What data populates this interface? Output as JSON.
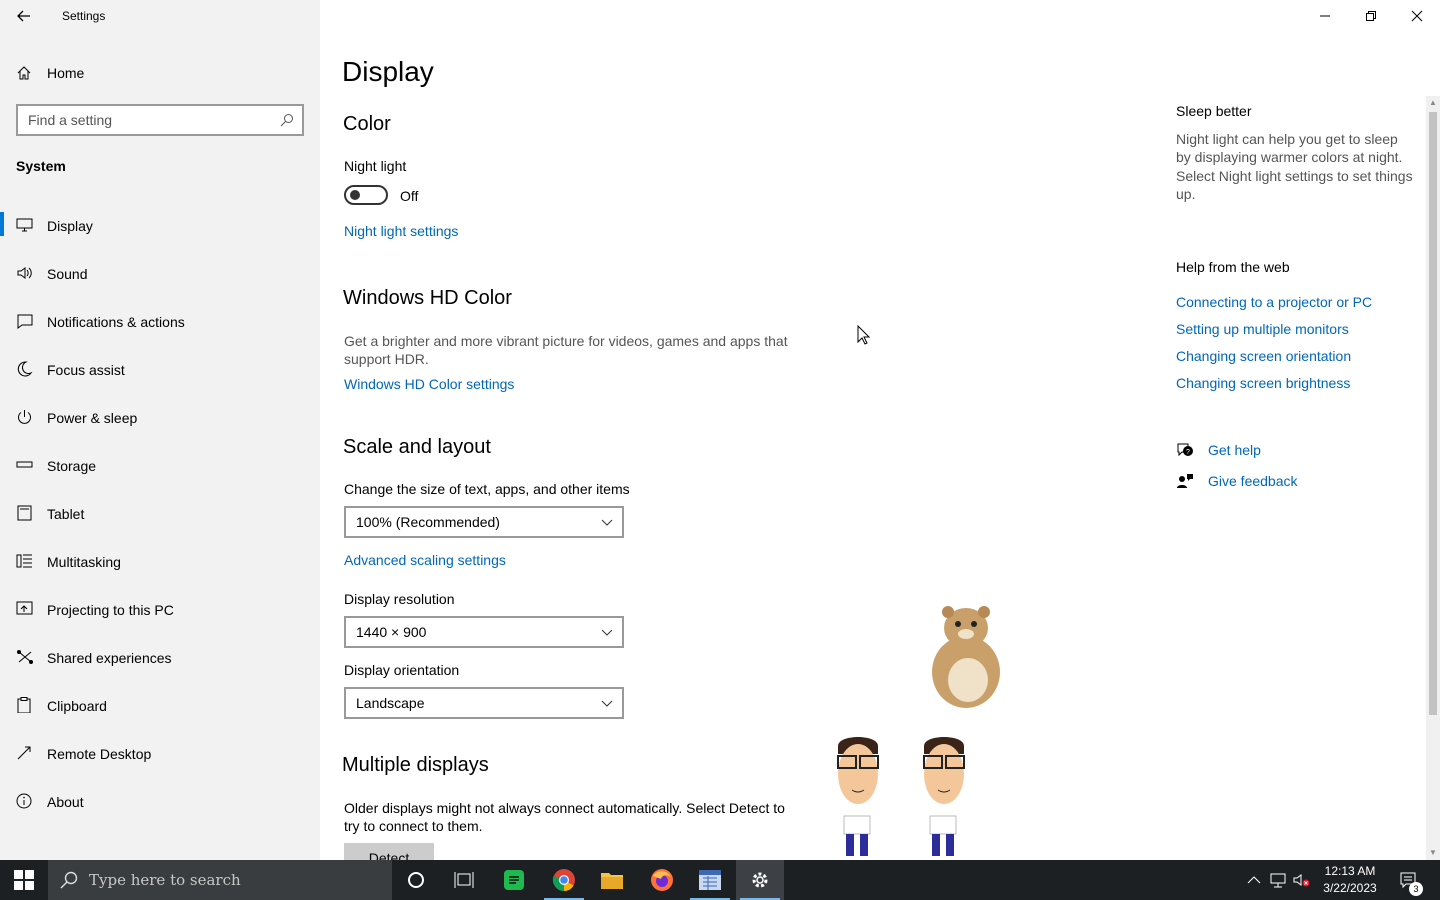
{
  "window": {
    "title": "Settings",
    "minimize_label": "Minimize",
    "restore_label": "Restore",
    "close_label": "Close"
  },
  "sidebar": {
    "home_label": "Home",
    "search_placeholder": "Find a setting",
    "section_label": "System",
    "items": [
      {
        "label": "Display",
        "icon": "monitor-icon"
      },
      {
        "label": "Sound",
        "icon": "speaker-icon"
      },
      {
        "label": "Notifications & actions",
        "icon": "notification-icon"
      },
      {
        "label": "Focus assist",
        "icon": "moon-icon"
      },
      {
        "label": "Power & sleep",
        "icon": "power-icon"
      },
      {
        "label": "Storage",
        "icon": "storage-icon"
      },
      {
        "label": "Tablet",
        "icon": "tablet-icon"
      },
      {
        "label": "Multitasking",
        "icon": "multitasking-icon"
      },
      {
        "label": "Projecting to this PC",
        "icon": "projecting-icon"
      },
      {
        "label": "Shared experiences",
        "icon": "shared-icon"
      },
      {
        "label": "Clipboard",
        "icon": "clipboard-icon"
      },
      {
        "label": "Remote Desktop",
        "icon": "remote-desktop-icon"
      },
      {
        "label": "About",
        "icon": "info-icon"
      }
    ]
  },
  "main": {
    "page_title": "Display",
    "color": {
      "heading": "Color",
      "night_light_label": "Night light",
      "night_light_state": "Off",
      "night_light_settings_link": "Night light settings"
    },
    "hd_color": {
      "heading": "Windows HD Color",
      "description_line1": "Get a brighter and more vibrant picture for videos, games and apps that",
      "description_line2": "support HDR.",
      "settings_link": "Windows HD Color settings"
    },
    "scale_layout": {
      "heading": "Scale and layout",
      "size_label": "Change the size of text, apps, and other items",
      "size_value": "100% (Recommended)",
      "advanced_link": "Advanced scaling settings",
      "resolution_label": "Display resolution",
      "resolution_value": "1440 × 900",
      "orientation_label": "Display orientation",
      "orientation_value": "Landscape"
    },
    "multiple_displays": {
      "heading": "Multiple displays",
      "description_line1": "Older displays might not always connect automatically. Select Detect to",
      "description_line2": "try to connect to them.",
      "detect_button": "Detect"
    }
  },
  "right_panel": {
    "sleep_heading": "Sleep better",
    "sleep_text_lines": [
      "Night light can help you get to sleep",
      "by displaying warmer colors at night.",
      "Select Night light settings to set things",
      "up."
    ],
    "help_heading": "Help from the web",
    "help_links": [
      "Connecting to a projector or PC",
      "Setting up multiple monitors",
      "Changing screen orientation",
      "Changing screen brightness"
    ],
    "get_help": "Get help",
    "give_feedback": "Give feedback"
  },
  "taskbar": {
    "search_placeholder": "Type here to search",
    "time": "12:13 AM",
    "date": "3/22/2023",
    "notification_count": "3"
  },
  "colors": {
    "accent": "#0078d7",
    "link": "#0067b8",
    "sidebar_bg": "#f2f2f2",
    "taskbar_bg": "#1d2023"
  }
}
